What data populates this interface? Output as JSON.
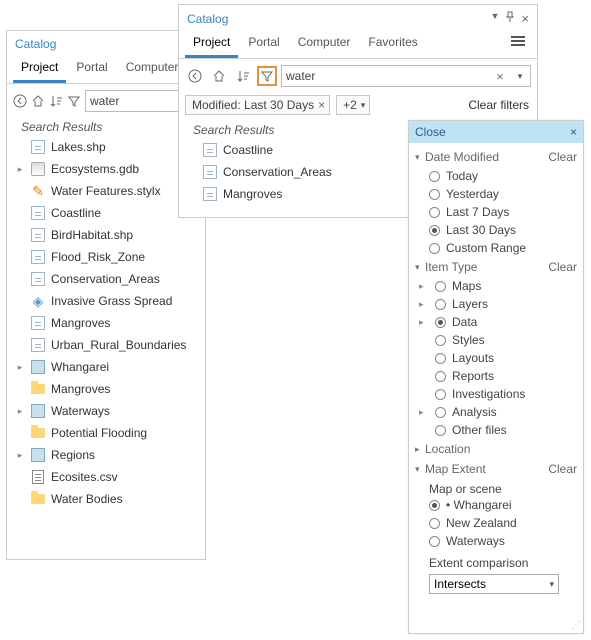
{
  "pane1": {
    "title": "Catalog",
    "tabs": [
      "Project",
      "Portal",
      "Computer"
    ],
    "activeTab": 0,
    "search": "water",
    "heading": "Search Results",
    "results": [
      {
        "icon": "fc",
        "label": "Lakes.shp",
        "expandable": false
      },
      {
        "icon": "gdb",
        "label": "Ecosystems.gdb",
        "expandable": true
      },
      {
        "icon": "style",
        "label": "Water Features.stylx",
        "expandable": false
      },
      {
        "icon": "fc",
        "label": "Coastline",
        "expandable": false
      },
      {
        "icon": "fc",
        "label": "BirdHabitat.shp",
        "expandable": false
      },
      {
        "icon": "fc",
        "label": "Flood_Risk_Zone",
        "expandable": false
      },
      {
        "icon": "fc",
        "label": "Conservation_Areas",
        "expandable": false
      },
      {
        "icon": "layer",
        "label": "Invasive Grass Spread",
        "expandable": false
      },
      {
        "icon": "fc",
        "label": "Mangroves",
        "expandable": false
      },
      {
        "icon": "fc",
        "label": "Urban_Rural_Boundaries",
        "expandable": false
      },
      {
        "icon": "map",
        "label": "Whangarei",
        "expandable": true
      },
      {
        "icon": "folder",
        "label": "Mangroves",
        "expandable": false
      },
      {
        "icon": "map",
        "label": "Waterways",
        "expandable": true
      },
      {
        "icon": "folder",
        "label": "Potential Flooding",
        "expandable": false
      },
      {
        "icon": "map",
        "label": "Regions",
        "expandable": true
      },
      {
        "icon": "csv",
        "label": "Ecosites.csv",
        "expandable": false
      },
      {
        "icon": "folder",
        "label": "Water Bodies",
        "expandable": false
      }
    ]
  },
  "pane2": {
    "title": "Catalog",
    "tabs": [
      "Project",
      "Portal",
      "Computer",
      "Favorites"
    ],
    "activeTab": 0,
    "search": "water",
    "filterChip": "Modified: Last 30 Days",
    "moreFilters": "+2",
    "clearFilters": "Clear filters",
    "heading": "Search Results",
    "results": [
      {
        "icon": "fc",
        "label": "Coastline"
      },
      {
        "icon": "fc",
        "label": "Conservation_Areas"
      },
      {
        "icon": "fc",
        "label": "Mangroves"
      }
    ]
  },
  "filterPanel": {
    "close": "Close",
    "sections": {
      "dateModified": {
        "title": "Date Modified",
        "clear": "Clear",
        "options": [
          "Today",
          "Yesterday",
          "Last 7 Days",
          "Last 30 Days",
          "Custom Range"
        ],
        "selected": 3
      },
      "itemType": {
        "title": "Item Type",
        "clear": "Clear",
        "options": [
          {
            "label": "Maps",
            "expandable": true
          },
          {
            "label": "Layers",
            "expandable": true
          },
          {
            "label": "Data",
            "expandable": true,
            "selected": true
          },
          {
            "label": "Styles",
            "expandable": false
          },
          {
            "label": "Layouts",
            "expandable": false
          },
          {
            "label": "Reports",
            "expandable": false
          },
          {
            "label": "Investigations",
            "expandable": false
          },
          {
            "label": "Analysis",
            "expandable": true
          },
          {
            "label": "Other files",
            "expandable": false
          }
        ]
      },
      "location": {
        "title": "Location"
      },
      "mapExtent": {
        "title": "Map Extent",
        "clear": "Clear",
        "subtitle": "Map or scene",
        "options": [
          {
            "label": "Whangarei",
            "selected": true,
            "bullet": true
          },
          {
            "label": "New Zealand"
          },
          {
            "label": "Waterways"
          }
        ],
        "extentLabel": "Extent comparison",
        "extentValue": "Intersects"
      }
    }
  }
}
